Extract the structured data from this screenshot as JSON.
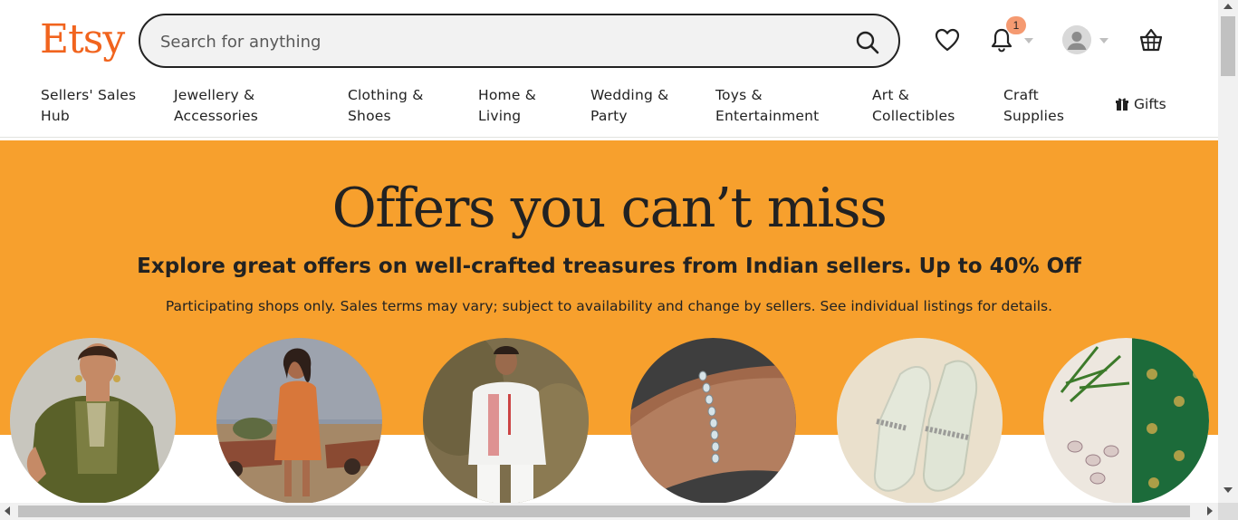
{
  "brand": {
    "logo": "Etsy",
    "accent": "#F1641E"
  },
  "search": {
    "placeholder": "Search for anything",
    "icon": "search-icon"
  },
  "header_icons": {
    "favorites": "heart-icon",
    "notifications": "bell-icon",
    "notification_count": "1",
    "account": "user-avatar-icon",
    "cart": "basket-icon"
  },
  "nav": {
    "items": [
      {
        "line1": "Sellers' Sales",
        "line2": "Hub"
      },
      {
        "line1": "Jewellery &",
        "line2": "Accessories"
      },
      {
        "line1": "Clothing &",
        "line2": "Shoes"
      },
      {
        "line1": "Home &",
        "line2": "Living"
      },
      {
        "line1": "Wedding &",
        "line2": "Party"
      },
      {
        "line1": "Toys &",
        "line2": "Entertainment"
      },
      {
        "line1": "Art &",
        "line2": "Collectibles"
      },
      {
        "line1": "Craft",
        "line2": "Supplies"
      }
    ],
    "gifts": "Gifts"
  },
  "banner": {
    "bg_color": "#F7A02D",
    "headline": "Offers you can’t miss",
    "subhead": "Explore great offers on well-crafted treasures from Indian sellers. Up to 40% Off",
    "fine_print": "Participating shops only. Sales terms may vary; subject to availability and change by sellers. See individual listings for details."
  },
  "categories": [
    {
      "name": "kurta-woman-image"
    },
    {
      "name": "orange-dress-image"
    },
    {
      "name": "white-kurta-man-image"
    },
    {
      "name": "bracelet-image"
    },
    {
      "name": "embellished-shoes-image"
    },
    {
      "name": "green-fabric-image"
    }
  ]
}
